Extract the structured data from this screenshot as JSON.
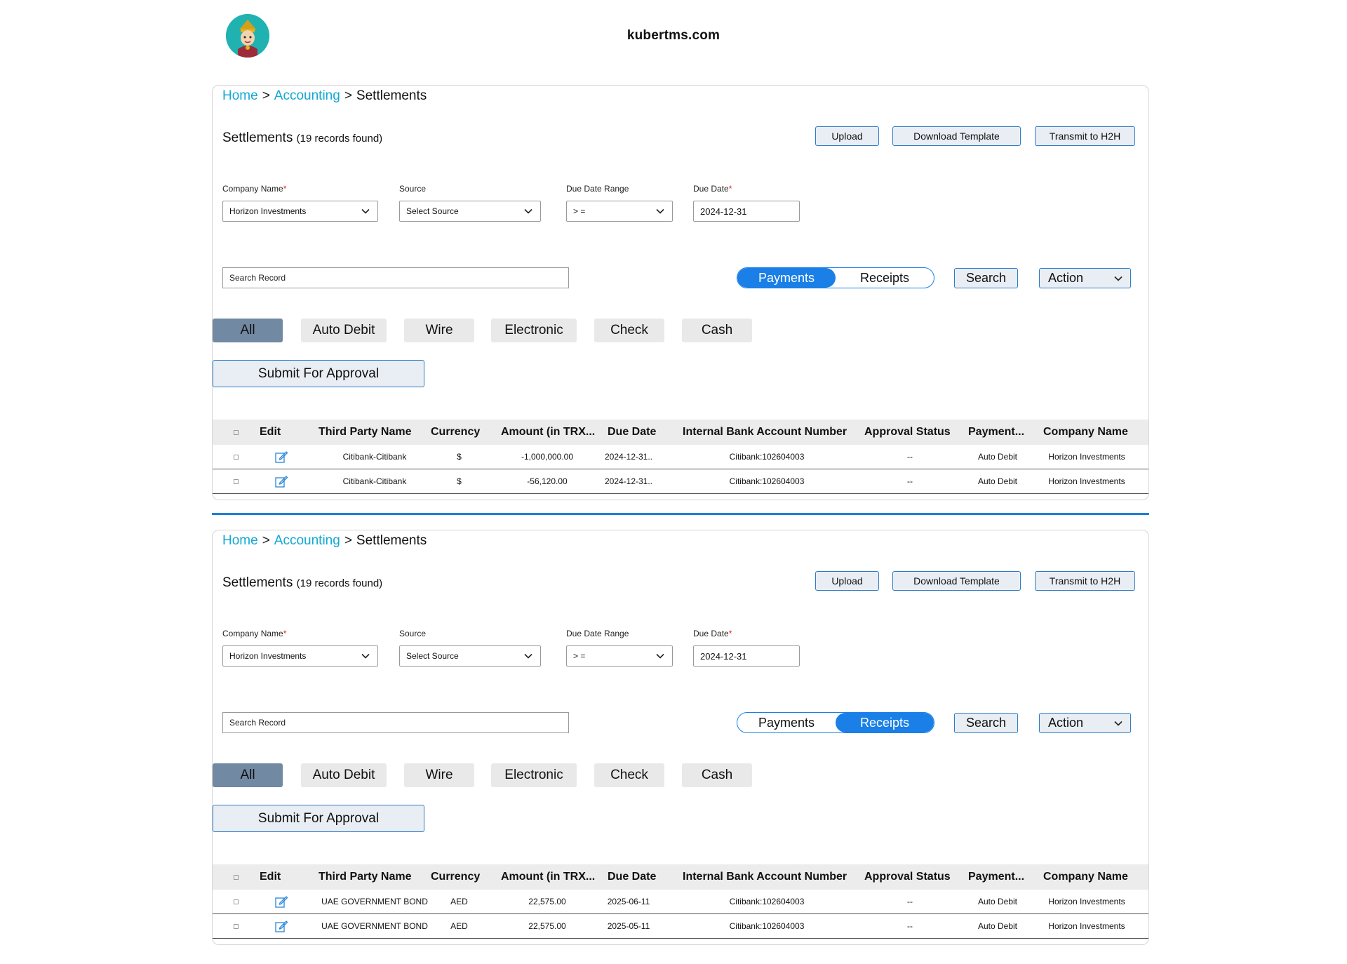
{
  "site": {
    "domain": "kubertms.com",
    "logo_icon": "deity-logo-icon"
  },
  "colors": {
    "accent": "#1a7fe6",
    "link": "#12a8d6",
    "active_filter": "#7189a3",
    "required": "#e02020"
  },
  "panels": [
    {
      "breadcrumb": {
        "home": "Home",
        "accounting": "Accounting",
        "current": "Settlements",
        "sep": ">"
      },
      "title": "Settlements",
      "records": "(19 records found)",
      "buttons": {
        "upload": "Upload",
        "download": "Download Template",
        "transmit": "Transmit to H2H"
      },
      "filters": {
        "company_label": "Company Name",
        "company_value": "Horizon Investments",
        "source_label": "Source",
        "source_value": "Select Source",
        "range_label": "Due Date Range",
        "range_value": "> =",
        "date_label": "Due Date",
        "date_value": "2024-12-31",
        "required_mark": "*"
      },
      "search_placeholder": "Search Record",
      "toggle": {
        "payments": "Payments",
        "receipts": "Receipts",
        "active": "Payments"
      },
      "search_btn": "Search",
      "action_btn": "Action",
      "types": [
        "All",
        "Auto Debit",
        "Wire",
        "Electronic",
        "Check",
        "Cash"
      ],
      "active_type": "All",
      "submit": "Submit For Approval",
      "columns": [
        "Edit",
        "Third Party Name",
        "Currency",
        "Amount (in TRX...",
        "Due Date",
        "Internal Bank Account Number",
        "Approval Status",
        "Payment...",
        "Company Name"
      ],
      "rows": [
        [
          "Citibank-Citibank",
          "$",
          "-1,000,000.00",
          "2024-12-31..",
          "Citibank:102604003",
          "--",
          "Auto Debit",
          "Horizon Investments"
        ],
        [
          "Citibank-Citibank",
          "$",
          "-56,120.00",
          "2024-12-31..",
          "Citibank:102604003",
          "--",
          "Auto Debit",
          "Horizon Investments"
        ]
      ]
    },
    {
      "breadcrumb": {
        "home": "Home",
        "accounting": "Accounting",
        "current": "Settlements",
        "sep": ">"
      },
      "title": "Settlements",
      "records": "(19 records found)",
      "buttons": {
        "upload": "Upload",
        "download": "Download Template",
        "transmit": "Transmit to H2H"
      },
      "filters": {
        "company_label": "Company Name",
        "company_value": "Horizon Investments",
        "source_label": "Source",
        "source_value": "Select Source",
        "range_label": "Due Date Range",
        "range_value": "> =",
        "date_label": "Due Date",
        "date_value": "2024-12-31",
        "required_mark": "*"
      },
      "search_placeholder": "Search Record",
      "toggle": {
        "payments": "Payments",
        "receipts": "Receipts",
        "active": "Receipts"
      },
      "search_btn": "Search",
      "action_btn": "Action",
      "types": [
        "All",
        "Auto Debit",
        "Wire",
        "Electronic",
        "Check",
        "Cash"
      ],
      "active_type": "All",
      "submit": "Submit For Approval",
      "columns": [
        "Edit",
        "Third Party Name",
        "Currency",
        "Amount (in TRX...",
        "Due Date",
        "Internal Bank Account Number",
        "Approval Status",
        "Payment...",
        "Company Name"
      ],
      "rows": [
        [
          "UAE GOVERNMENT BOND",
          "AED",
          "22,575.00",
          "2025-06-11",
          "Citibank:102604003",
          "--",
          "Auto Debit",
          "Horizon Investments"
        ],
        [
          "UAE GOVERNMENT BOND",
          "AED",
          "22,575.00",
          "2025-05-11",
          "Citibank:102604003",
          "--",
          "Auto Debit",
          "Horizon Investments"
        ]
      ]
    }
  ]
}
